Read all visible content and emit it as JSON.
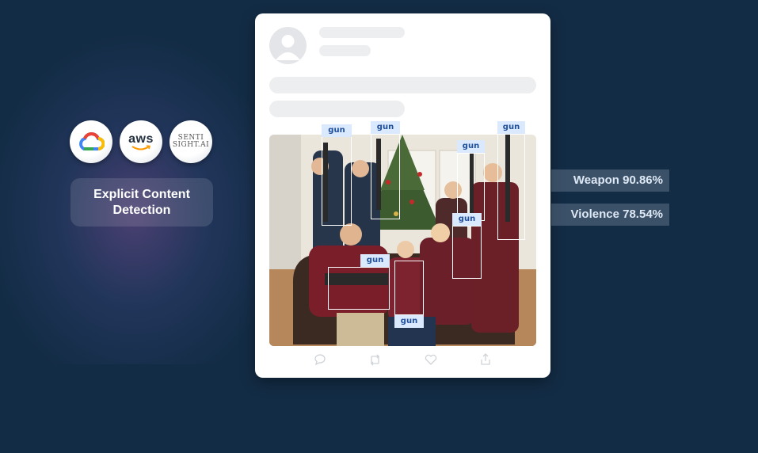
{
  "badge": {
    "line1": "Explicit Content",
    "line2": "Detection"
  },
  "providers": [
    {
      "name": "google-cloud-logo"
    },
    {
      "name": "aws-logo",
      "text": "aws"
    },
    {
      "name": "sentisight-logo",
      "text_top": "SENTI",
      "text_bottom": "SIGHT.AI"
    }
  ],
  "detections": {
    "label": "gun",
    "labels": [
      "gun",
      "gun",
      "gun",
      "gun",
      "gun",
      "gun",
      "gun"
    ]
  },
  "results": [
    {
      "label": "Weapon 90.86%"
    },
    {
      "label": "Violence 78.54%"
    }
  ],
  "post_actions": [
    "comment-icon",
    "repost-icon",
    "like-icon",
    "share-icon"
  ],
  "colors": {
    "background": "#132c45",
    "tag_bg": "#dbe9ff",
    "tag_text": "#1f4f9a"
  }
}
